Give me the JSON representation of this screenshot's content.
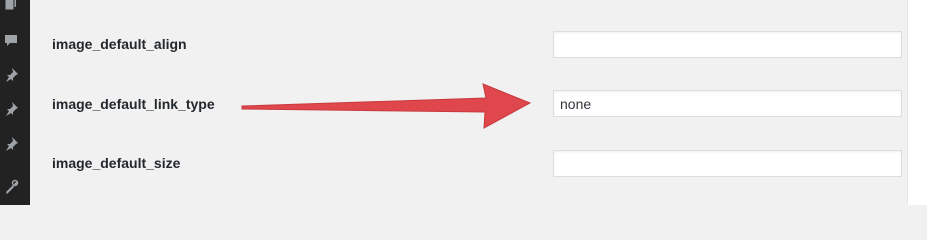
{
  "sidebar": {
    "icons": [
      "pages-icon",
      "comments-icon",
      "pin-icon",
      "pin-icon",
      "pin-icon",
      "tools-icon"
    ]
  },
  "options": [
    {
      "label": "image_default_align",
      "value": ""
    },
    {
      "label": "image_default_link_type",
      "value": "none"
    },
    {
      "label": "image_default_size",
      "value": ""
    }
  ],
  "annotation": {
    "arrow_color": "#e0474c",
    "icon": "arrow-right-icon"
  },
  "colors": {
    "sidebar_bg": "#222222",
    "sidebar_icon": "#9ea3a8",
    "content_bg": "#f1f1f1"
  }
}
